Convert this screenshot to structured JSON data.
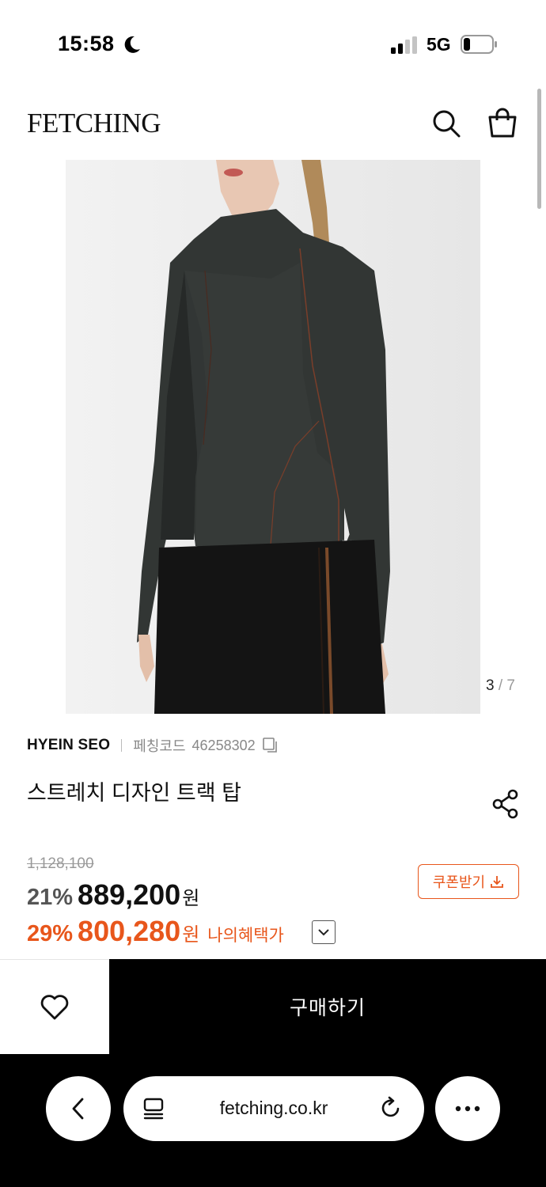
{
  "status_bar": {
    "time": "15:58",
    "network": "5G",
    "icons": [
      "moon-icon",
      "signal-icon",
      "battery-icon"
    ]
  },
  "header": {
    "logo": "FETCHING",
    "icons": [
      "search-icon",
      "shopping-bag-icon"
    ]
  },
  "gallery": {
    "current": "3",
    "separator": "/",
    "total": "7"
  },
  "product": {
    "brand": "HYEIN SEO",
    "code_label": "페칭코드",
    "code_value": "46258302",
    "title": "스트레치 디자인 트랙 탑"
  },
  "pricing": {
    "original_price": "1,128,100",
    "discount1": "21%",
    "price1": "889,200",
    "won1": "원",
    "discount2": "29%",
    "price2": "800,280",
    "won2": "원",
    "benefit_label": "나의혜택가"
  },
  "coupon": {
    "label": "쿠폰받기"
  },
  "purchase_bar": {
    "buy_label": "구매하기"
  },
  "browser": {
    "url": "fetching.co.kr",
    "icons": [
      "back-icon",
      "tabs-icon",
      "reload-icon",
      "more-icon"
    ]
  },
  "colors": {
    "accent": "#e8561b",
    "buy_button": "#000000",
    "text": "#111111",
    "muted": "#888888"
  }
}
